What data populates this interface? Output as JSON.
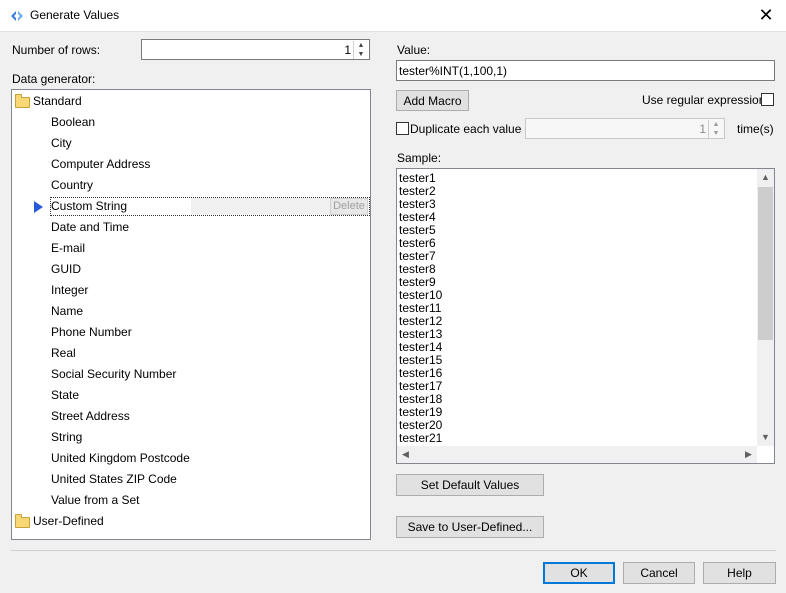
{
  "window": {
    "title": "Generate Values",
    "close_glyph": "✕"
  },
  "rows": {
    "label": "Number of rows:",
    "value": "1"
  },
  "generator": {
    "label": "Data generator:",
    "standard_folder": "Standard",
    "items": [
      "Boolean",
      "City",
      "Computer Address",
      "Country",
      "Custom String",
      "Date and Time",
      "E-mail",
      "GUID",
      "Integer",
      "Name",
      "Phone Number",
      "Real",
      "Social Security Number",
      "State",
      "Street Address",
      "String",
      "United Kingdom Postcode",
      "United States ZIP Code",
      "Value from a Set"
    ],
    "selected_index": 4,
    "delete_label": "Delete",
    "user_folder": "User-Defined"
  },
  "value": {
    "label": "Value:",
    "text": "tester%INT(1,100,1)"
  },
  "add_macro_label": "Add Macro",
  "regex": {
    "label": "Use regular expressions",
    "checked": false
  },
  "duplicate": {
    "label": "Duplicate each value",
    "checked": false,
    "count": "1",
    "suffix": "time(s)"
  },
  "sample": {
    "label": "Sample:",
    "lines": [
      "tester1",
      "tester2",
      "tester3",
      "tester4",
      "tester5",
      "tester6",
      "tester7",
      "tester8",
      "tester9",
      "tester10",
      "tester11",
      "tester12",
      "tester13",
      "tester14",
      "tester15",
      "tester16",
      "tester17",
      "tester18",
      "tester19",
      "tester20",
      "tester21"
    ]
  },
  "set_default_label": "Set Default Values",
  "save_user_label": "Save to User-Defined...",
  "footer": {
    "ok": "OK",
    "cancel": "Cancel",
    "help": "Help"
  }
}
